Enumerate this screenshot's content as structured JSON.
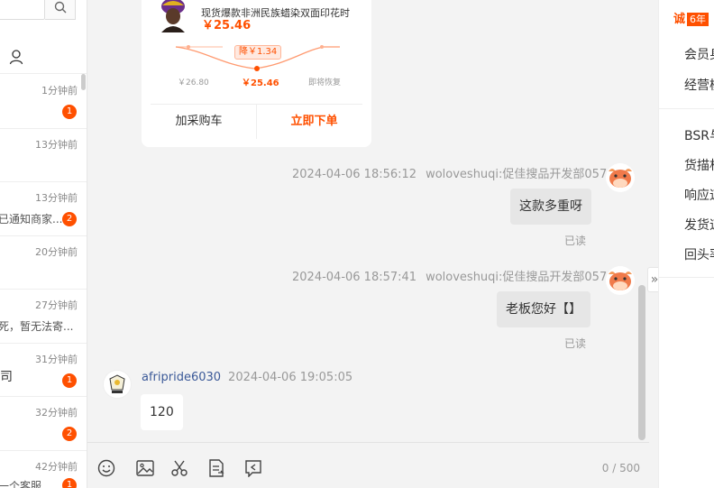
{
  "conversations": [
    {
      "time": "1分钟前",
      "preview": "",
      "badge": "1"
    },
    {
      "time": "13分钟前",
      "preview": "",
      "badge": ""
    },
    {
      "time": "13分钟前",
      "preview": "已通知商家...",
      "badge": "2"
    },
    {
      "time": "20分钟前",
      "preview": "",
      "badge": ""
    },
    {
      "time": "27分钟前",
      "preview": "死，暂无法寄...",
      "badge": ""
    },
    {
      "time": "31分钟前",
      "preview": "司",
      "badge": "1"
    },
    {
      "time": "32分钟前",
      "preview": "",
      "badge": "2"
    },
    {
      "time": "42分钟前",
      "preview": "一个客服",
      "badge": "1"
    }
  ],
  "product_card": {
    "title": "现货爆款非洲民族蜡染双面印花时",
    "price": "￥25.46",
    "price_drop_tag": "降￥1.34",
    "label_original": "￥26.80",
    "label_now": "￥25.46",
    "label_recover": "即将恢复",
    "add_cart": "加采购车",
    "buy_now": "立即下单"
  },
  "messages": [
    {
      "timestamp": "2024-04-06 18:56:12",
      "sender": "woloveshuqi:促佳搜品开发部057",
      "text": "这款多重呀",
      "status": "已读"
    },
    {
      "timestamp": "2024-04-06 18:57:41",
      "sender": "woloveshuqi:促佳搜品开发部057",
      "text": "老板您好【】",
      "status": "已读"
    },
    {
      "timestamp": "2024-04-06 19:05:05",
      "sender": "afripride6030",
      "text": "120",
      "status": ""
    }
  ],
  "input": {
    "counter": "0 / 500"
  },
  "right_panel": {
    "cheng": "诚",
    "years": "6年",
    "items_top": [
      "会员身",
      "经营模"
    ],
    "items_bottom": [
      "BSR与",
      "货描相",
      "响应速",
      "发货速",
      "回头率"
    ]
  },
  "colors": {
    "accent": "#ff5000",
    "sender_link": "#3b5998"
  }
}
